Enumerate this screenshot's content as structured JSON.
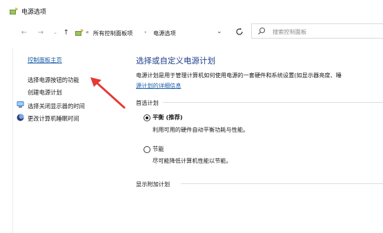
{
  "window": {
    "title": "电源选项"
  },
  "address_bar": {
    "overflow": "«",
    "crumbs": [
      "所有控制面板项",
      "电源选项"
    ],
    "separator": "›",
    "search_placeholder": "搜索控制面板"
  },
  "sidebar": {
    "home_link": "控制面板主页",
    "tasks": [
      {
        "label": "选择电源按钮的功能"
      },
      {
        "label": "创建电源计划"
      },
      {
        "label": "选择关闭显示器的时间"
      },
      {
        "label": "更改计算机睡眠时间"
      }
    ]
  },
  "main": {
    "title": "选择或自定义电源计划",
    "description": "电源计划是用于管理计算机如何使用电源的一套硬件和系统设置(如显示器亮度、睡",
    "description_link": "源计划的详细信息",
    "preferred_group": "首选计划",
    "plans": [
      {
        "name": "平衡 (推荐)",
        "description": "利用可用的硬件自动平衡功耗与性能。",
        "selected": true
      },
      {
        "name": "节能",
        "description": "尽可能降低计算机性能以节能。",
        "selected": false
      }
    ],
    "additional_group": "显示附加计划"
  },
  "colors": {
    "link": "#1a5ea8",
    "title": "#1f3e8c",
    "annotation_arrow": "#e53935"
  }
}
